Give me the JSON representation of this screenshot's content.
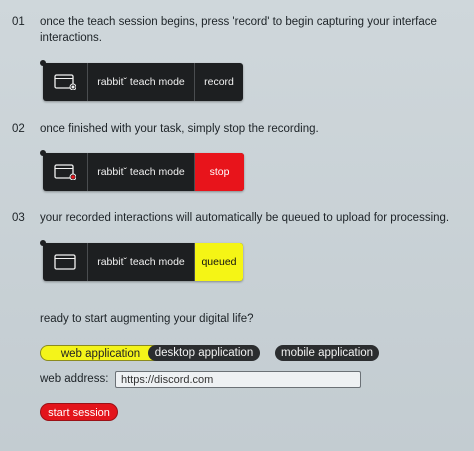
{
  "steps": [
    {
      "num": "01",
      "text": "once the teach session begins, press 'record' to begin capturing your interface interactions."
    },
    {
      "num": "02",
      "text": "once finished with your task, simply stop the recording."
    },
    {
      "num": "03",
      "text": "your recorded interactions will automatically be queued to upload for processing."
    }
  ],
  "widgets": [
    {
      "mode_label": "rabbitˇ teach mode",
      "action_label": "record",
      "state_indicator": "white-dot",
      "icon": "screen-icon"
    },
    {
      "mode_label": "rabbitˇ teach mode",
      "action_label": "stop",
      "state_indicator": "red-dot",
      "icon": "screen-icon",
      "action_color": "#e8141b"
    },
    {
      "mode_label": "rabbitˇ teach mode",
      "action_label": "queued",
      "state_indicator": "none",
      "icon": "screen-icon",
      "action_color": "#f5f515"
    }
  ],
  "prompt": "ready to start augmenting your digital life?",
  "app_types": [
    {
      "label": "web application",
      "selected": true
    },
    {
      "label": "desktop application",
      "selected": false
    },
    {
      "label": "mobile application",
      "selected": false
    }
  ],
  "web_address": {
    "label": "web address:",
    "value": "https://discord.com"
  },
  "start_button": "start session",
  "colors": {
    "accent_yellow": "#f4f41a",
    "accent_red": "#e3141b",
    "dark": "#1d1f21",
    "background": "#cfd7db"
  }
}
